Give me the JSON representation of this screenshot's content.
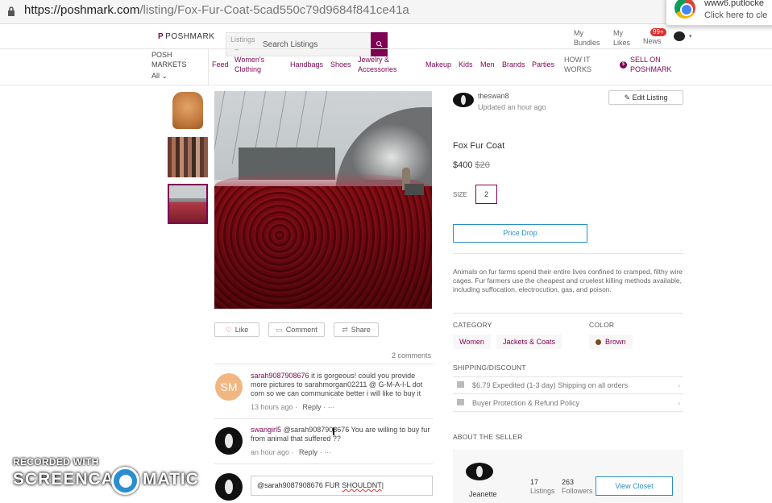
{
  "browser": {
    "url_host": "https://poshmark.com",
    "url_path": "/listing/Fox-Fur-Coat-5cad550c79d9684f841ce41a",
    "popup_title": "www6.putlocke",
    "popup_sub": "Click here to cle"
  },
  "header": {
    "logo": "POSHMARK",
    "search_scope": "Listings",
    "search_scope_dash": "–",
    "search_placeholder": "Search Listings",
    "links": [
      {
        "label": "My\nBundles"
      },
      {
        "label": "My\nLikes"
      },
      {
        "label": "News"
      }
    ],
    "news_badge": "99+"
  },
  "nav": {
    "posh_markets": "POSH\nMARKETS",
    "all": "All",
    "items": [
      "Feed",
      "Women's\nClothing",
      "Handbags",
      "Shoes",
      "Jewelry &\nAccessories",
      "Makeup",
      "Kids",
      "Men",
      "Brands",
      "Parties"
    ],
    "how_it_works": "HOW IT\nWORKS",
    "sell_badge": "$",
    "sell": "SELL ON\nPOSHMARK"
  },
  "actions": {
    "like": "Like",
    "comment": "Comment",
    "share": "Share"
  },
  "comments": {
    "count": "2 comments",
    "list": [
      {
        "avatar": "SM",
        "user": "sarah9087908676",
        "text": "it is gorgeous! could you provide more pictures to sarahmorgan02211 @ G-M-A-I-L dot com so we can communicate better i will like to buy it",
        "time": "13 hours ago",
        "reply": "Reply",
        "more": "···"
      },
      {
        "avatar": "",
        "user": "swangirl5",
        "text": "@sarah9087908676 You are willing to buy fur from animal that suffered ??",
        "time": "an hour ago",
        "reply": "Reply",
        "more": "···"
      }
    ],
    "input_value_a": "@sarah9087908676 FUR ",
    "input_value_b": "SHOULDNT"
  },
  "listing": {
    "seller": "theswan8",
    "updated": "Updated an hour ago",
    "edit": "Edit Listing",
    "title": "Fox Fur Coat",
    "price": "$400",
    "original_price": "$20",
    "size_label": "SIZE",
    "size": "2",
    "price_drop": "Price Drop",
    "description": "Animals on fur farms spend their entire lives confined to cramped, filthy wire cages. Fur farmers use the cheapest and cruelest killing methods available, including suffocation, electrocution, gas, and poison.",
    "category_label": "CATEGORY",
    "categories": [
      "Women",
      "Jackets & Coats"
    ],
    "color_label": "COLOR",
    "color": "Brown",
    "color_hex": "#7b4a1c",
    "shipping_label": "SHIPPING/DISCOUNT",
    "shipping": "$6.79 Expedited (1-3 day) Shipping on all orders",
    "protection": "Buyer Protection & Refund Policy",
    "about_label": "ABOUT THE SELLER",
    "about_name": "Jeanette",
    "listings_num": "17",
    "listings_lbl": "Listings",
    "followers_num": "263",
    "followers_lbl": "Followers",
    "view_closet": "View Closet"
  },
  "watermark": {
    "top": "RECORDED WITH",
    "left": "SCREENCAST",
    "right": "MATIC"
  },
  "colors": {
    "brand": "#7f0353",
    "link_blue": "#2a8ec8"
  }
}
